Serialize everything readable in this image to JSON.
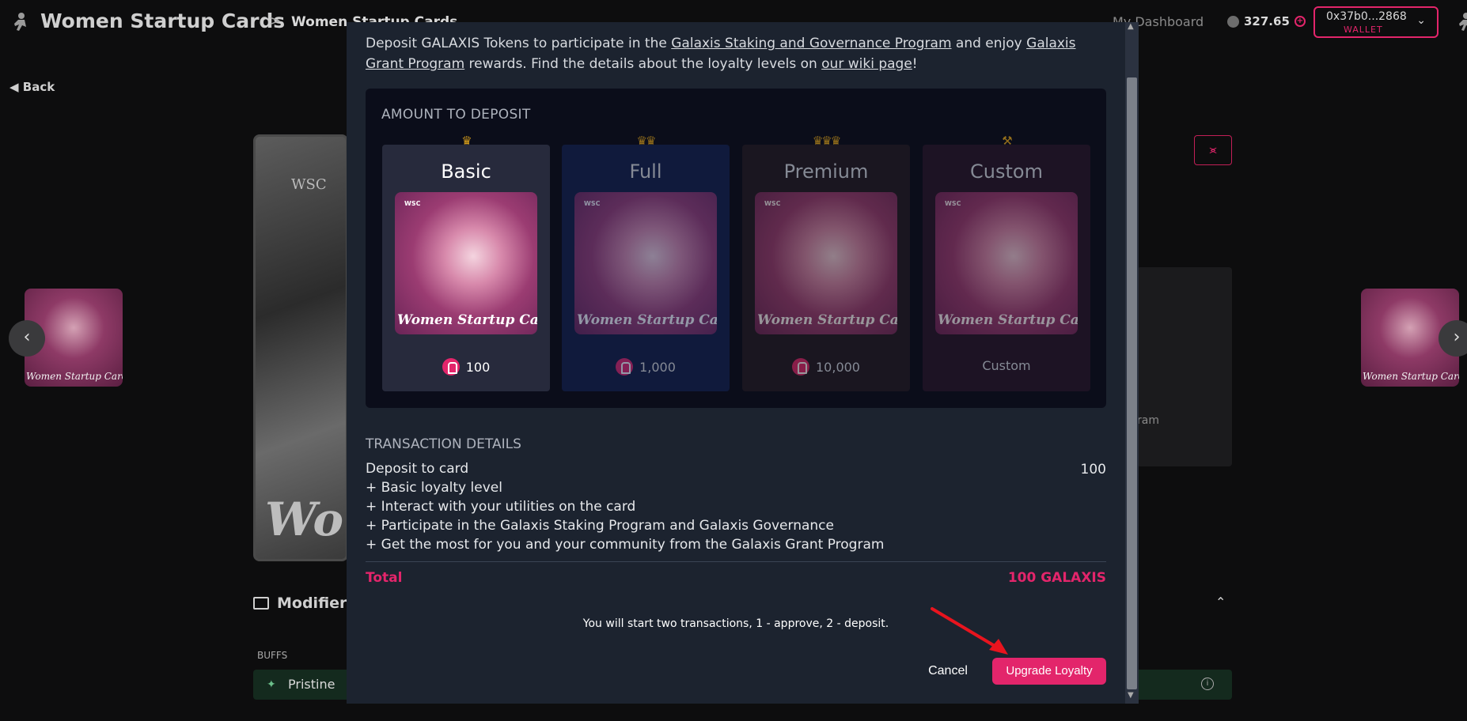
{
  "header": {
    "app_title": "Women Startup Cards",
    "breadcrumb_sep": ">",
    "breadcrumb": "Women Startup Cards",
    "dashboard_link": "My Dashboard",
    "balance": "327.65",
    "wallet_address": "0x37b0...2868",
    "wallet_label": "WALLET"
  },
  "page": {
    "back_label": "Back",
    "main_card_text": "Wom",
    "main_card_logo": "WSC",
    "side_card_caption": "Women Startup Cards",
    "panel_text": "ram",
    "modifiers_label": "Modifiers",
    "buffs_label": "BUFFS",
    "buff_name": "Pristine"
  },
  "modal": {
    "intro_1": "Deposit GALAXIS Tokens to participate in the ",
    "intro_link_1": "Galaxis Staking and Governance Program",
    "intro_2": " and enjoy ",
    "intro_link_2": "Galaxis Grant Program",
    "intro_3": " rewards. Find the details about the loyalty levels on ",
    "intro_link_3": "our wiki page",
    "intro_4": "!",
    "deposit_title": "AMOUNT TO DEPOSIT",
    "card_caption": "Women Startup Cards",
    "card_logo": "WSC",
    "tiers": [
      {
        "name": "Basic",
        "price": "100",
        "crowns": "♛"
      },
      {
        "name": "Full",
        "price": "1,000",
        "crowns": "♛♛"
      },
      {
        "name": "Premium",
        "price": "10,000",
        "crowns": "♛♛♛"
      },
      {
        "name": "Custom",
        "price": "Custom",
        "crowns": "⚒"
      }
    ],
    "selected_tier": "Basic",
    "tx_title": "TRANSACTION DETAILS",
    "tx_lines": [
      "Deposit to card",
      "+ Basic loyalty level",
      "+ Interact with your utilities on the card",
      "+ Participate in the Galaxis Staking Program and Galaxis Governance",
      "+ Get the most for you and your community from the Galaxis Grant Program"
    ],
    "tx_amount": "100",
    "total_label": "Total",
    "total_value": "100 GALAXIS",
    "note": "You will start two transactions, 1 - approve, 2 - deposit.",
    "cancel_label": "Cancel",
    "upgrade_label": "Upgrade Loyalty"
  },
  "colors": {
    "accent": "#e3256b",
    "modal_bg": "#1c232f",
    "page_bg": "#0d0d0e",
    "crown_gold": "#d19a1c"
  },
  "icons": {
    "logo": "astronaut-icon",
    "balance": "galaxis-coin-icon",
    "add": "plus-circle-icon",
    "wallet_menu": "chevron-down-icon",
    "back": "arrow-left-icon",
    "share": "share-icon",
    "annotation": "red-arrow-icon"
  }
}
